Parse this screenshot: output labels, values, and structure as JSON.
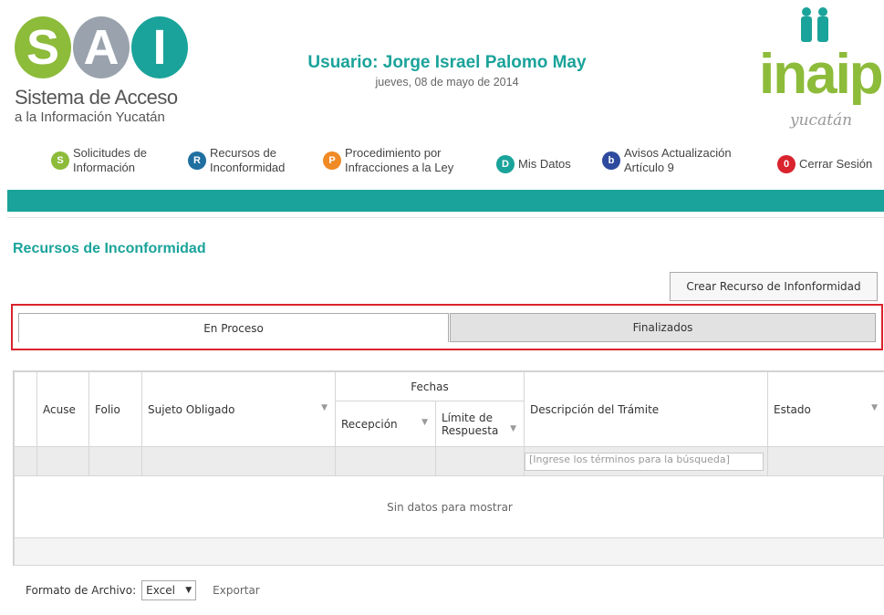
{
  "logo": {
    "letters": [
      "S",
      "A",
      "I"
    ],
    "title": "Sistema de Acceso",
    "subtitle": "a la Información Yucatán"
  },
  "user": {
    "name": "Usuario: Jorge Israel Palomo May",
    "date": "jueves, 08 de mayo de 2014"
  },
  "brand": {
    "name": "inaip",
    "region": "yucatán"
  },
  "nav": [
    {
      "icon": "S",
      "label": "Solicitudes de\nInformación",
      "color": "#8dbb3a"
    },
    {
      "icon": "R",
      "label": "Recursos de\nInconformidad",
      "color": "#1f6fa0"
    },
    {
      "icon": "P",
      "label": "Procedimiento por\nInfracciones a la Ley",
      "color": "#f08a24"
    },
    {
      "icon": "D",
      "label": "Mis Datos",
      "color": "#1aa39a"
    },
    {
      "icon": "b",
      "label": "Avisos Actualización\nArtículo 9",
      "color": "#2e4a9e"
    },
    {
      "icon": "0",
      "label": "Cerrar Sesión",
      "color": "#d9232d"
    }
  ],
  "page": {
    "title": "Recursos de Inconformidad",
    "create_button": "Crear Recurso de Infonformidad"
  },
  "tabs": {
    "active": "En Proceso",
    "inactive": "Finalizados"
  },
  "grid": {
    "headers": {
      "acuse": "Acuse",
      "folio": "Folio",
      "sujeto": "Sujeto Obligado",
      "fechas": "Fechas",
      "recepcion": "Recepción",
      "limite": "Límite de Respuesta",
      "descripcion": "Descripción del Trámite",
      "estado": "Estado"
    },
    "search_placeholder": "[Ingrese los términos para la búsqueda]",
    "empty_text": "Sin datos para mostrar"
  },
  "export": {
    "label": "Formato de Archivo:",
    "format": "Excel",
    "link": "Exportar"
  },
  "colors": {
    "accent": "#1aa39a",
    "highlight": "#d9232d",
    "brand_green": "#8dbb3a"
  }
}
